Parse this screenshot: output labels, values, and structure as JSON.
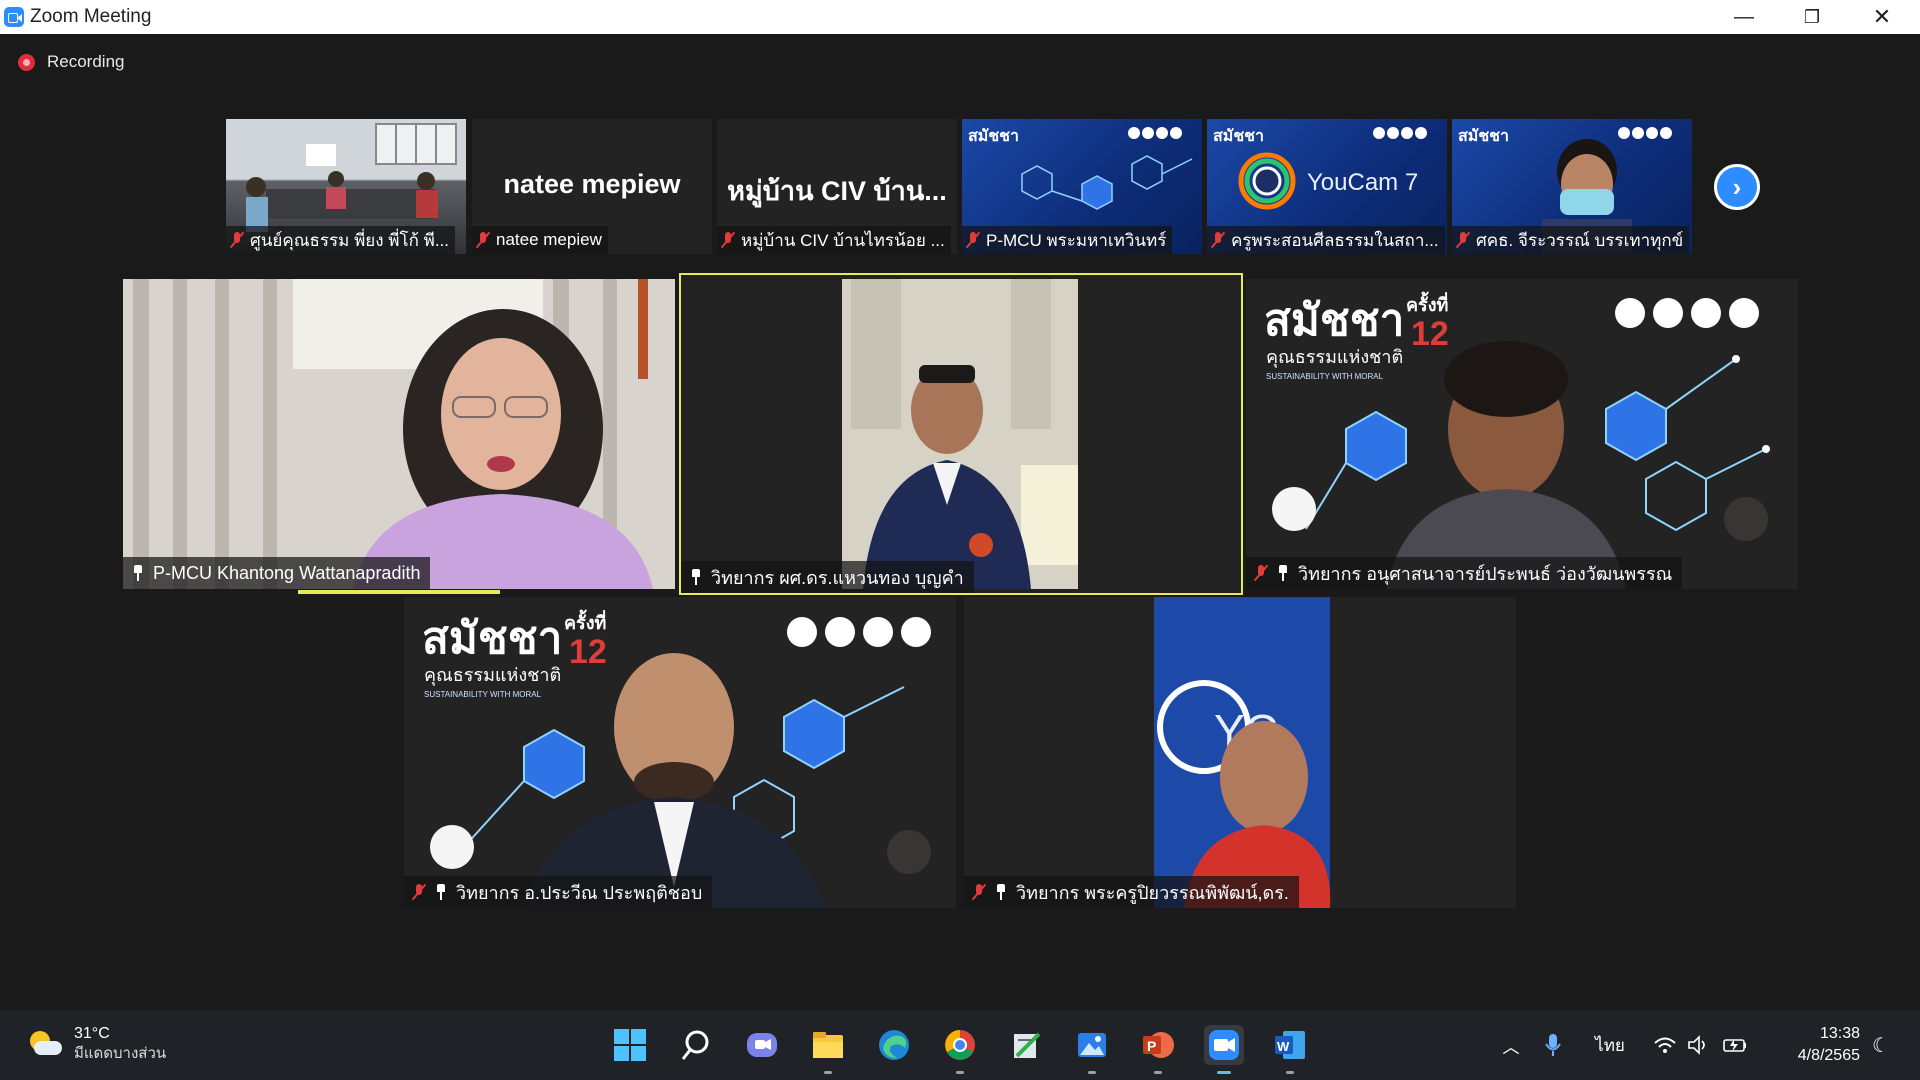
{
  "window": {
    "title": "Zoom Meeting",
    "minimize": "—",
    "maximize": "❐",
    "close": "✕"
  },
  "recording_label": "Recording",
  "thumbnails": [
    {
      "name": "ศูนย์คุณธรรม พี่ยง พี่โก้ พี...",
      "kind": "video-office"
    },
    {
      "name": "natee mepiew",
      "display": "natee mepiew",
      "kind": "name-only"
    },
    {
      "name": "หมู่บ้าน CIV บ้านไทรน้อย ...",
      "display": "หมู่บ้าน CIV บ้าน...",
      "kind": "name-only"
    },
    {
      "name": "P-MCU พระมหาเทวินทร์",
      "kind": "video-blue"
    },
    {
      "name": "ครูพระสอนศีลธรรมในสถา...",
      "kind": "video-youcam",
      "overlay": "YouCam 7"
    },
    {
      "name": "ศคธ. จีระวรรณ์ บรรเทาทุกข์",
      "kind": "video-person"
    }
  ],
  "participants": [
    {
      "name": "P-MCU Khantong Wattanapradith",
      "muted": false
    },
    {
      "name": "วิทยากร ผศ.ดร.แหวนทอง บุญคำ",
      "muted": false
    },
    {
      "name": "วิทยากร อนุศาสนาจารย์ประพนธ์ ว่องวัฒนพรรณ",
      "muted": true
    },
    {
      "name": "วิทยากร อ.ประวีณ ประพฤติชอบ",
      "muted": true
    },
    {
      "name": "วิทยากร พระครูปิยวรรณพิพัฒน์,ดร.",
      "muted": true
    }
  ],
  "banner": {
    "title": "สมัชชา",
    "suffix": "ครั้งที่",
    "number": "12",
    "subtitle": "คุณธรรมแห่งชาติ",
    "tagline": "SUSTAINABILITY WITH MORAL",
    "brand_color": "#1b49a8"
  },
  "taskbar": {
    "weather_temp": "31°C",
    "weather_desc": "มีแดดบางส่วน",
    "language": "ไทย",
    "time": "13:38",
    "date": "4/8/2565"
  }
}
